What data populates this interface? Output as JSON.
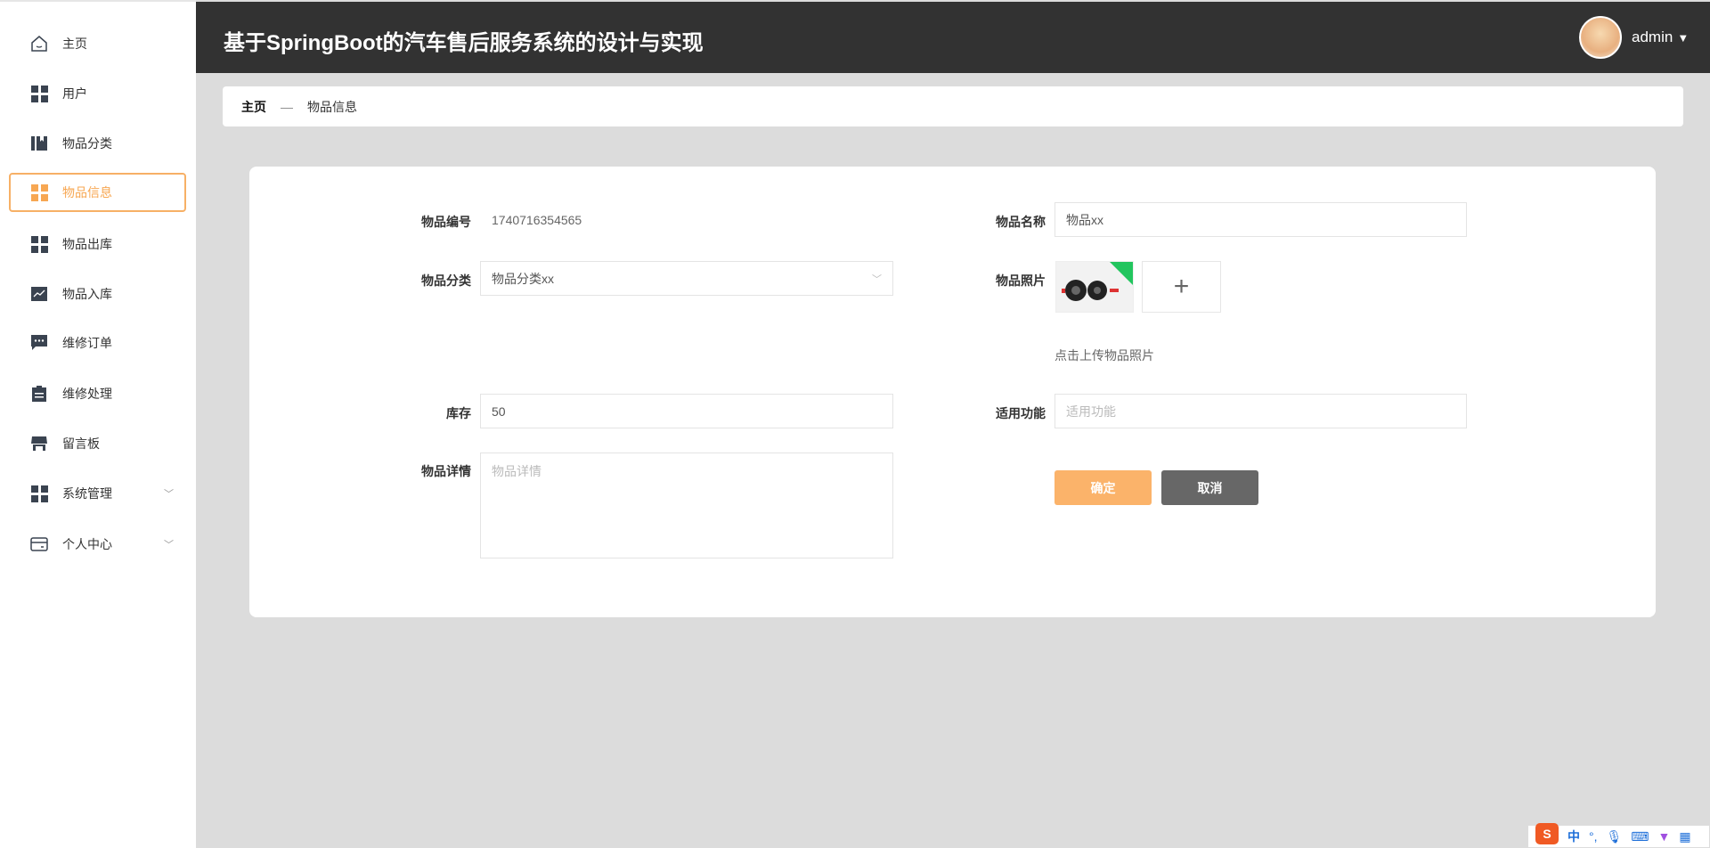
{
  "sidebar": {
    "items": [
      {
        "label": "主页",
        "icon": "home-icon"
      },
      {
        "label": "用户",
        "icon": "grid-icon"
      },
      {
        "label": "物品分类",
        "icon": "book-icon"
      },
      {
        "label": "物品信息",
        "icon": "grid-icon",
        "active": true
      },
      {
        "label": "物品出库",
        "icon": "grid-icon"
      },
      {
        "label": "物品入库",
        "icon": "chart-icon"
      },
      {
        "label": "维修订单",
        "icon": "message-icon"
      },
      {
        "label": "维修处理",
        "icon": "clipboard-icon"
      },
      {
        "label": "留言板",
        "icon": "store-icon"
      },
      {
        "label": "系统管理",
        "icon": "grid-icon"
      },
      {
        "label": "个人中心",
        "icon": "wallet-icon"
      }
    ]
  },
  "header": {
    "title": "基于SpringBoot的汽车售后服务系统的设计与实现",
    "user": "admin"
  },
  "breadcrumb": {
    "home": "主页",
    "sep": "—",
    "current": "物品信息"
  },
  "form": {
    "code_label": "物品编号",
    "code_value": "1740716354565",
    "name_label": "物品名称",
    "name_value": "物品xx",
    "category_label": "物品分类",
    "category_value": "物品分类xx",
    "photo_label": "物品照片",
    "photo_hint": "点击上传物品照片",
    "stock_label": "库存",
    "stock_value": "50",
    "function_label": "适用功能",
    "function_placeholder": "适用功能",
    "detail_label": "物品详情",
    "detail_placeholder": "物品详情",
    "confirm": "确定",
    "cancel": "取消"
  },
  "colors": {
    "accent": "#f7b066",
    "header": "#323232",
    "cancel": "#676767"
  },
  "ime": {
    "mode": "中",
    "punct": "°,"
  }
}
